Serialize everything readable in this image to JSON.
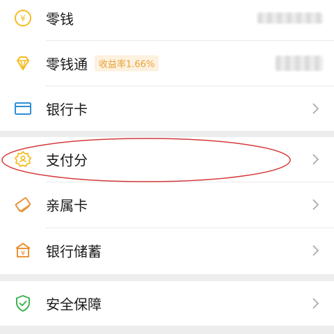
{
  "colors": {
    "gold": "#f5bb1e",
    "blue": "#2c8fd6",
    "orange": "#e8943a",
    "green": "#3cb34f",
    "annotation": "#d43a3a"
  },
  "rows": {
    "wallet": {
      "label": "零钱",
      "icon": "yuan-coin-icon"
    },
    "wallet_plus": {
      "label": "零钱通",
      "badge": "收益率1.66%",
      "icon": "diamond-icon"
    },
    "bank_card": {
      "label": "银行卡",
      "icon": "card-icon"
    },
    "pay_score": {
      "label": "支付分",
      "icon": "badge-person-icon"
    },
    "family_card": {
      "label": "亲属卡",
      "icon": "cards-icon"
    },
    "bank_savings": {
      "label": "银行储蓄",
      "icon": "bank-yuan-icon"
    },
    "security": {
      "label": "安全保障",
      "icon": "shield-check-icon"
    }
  }
}
